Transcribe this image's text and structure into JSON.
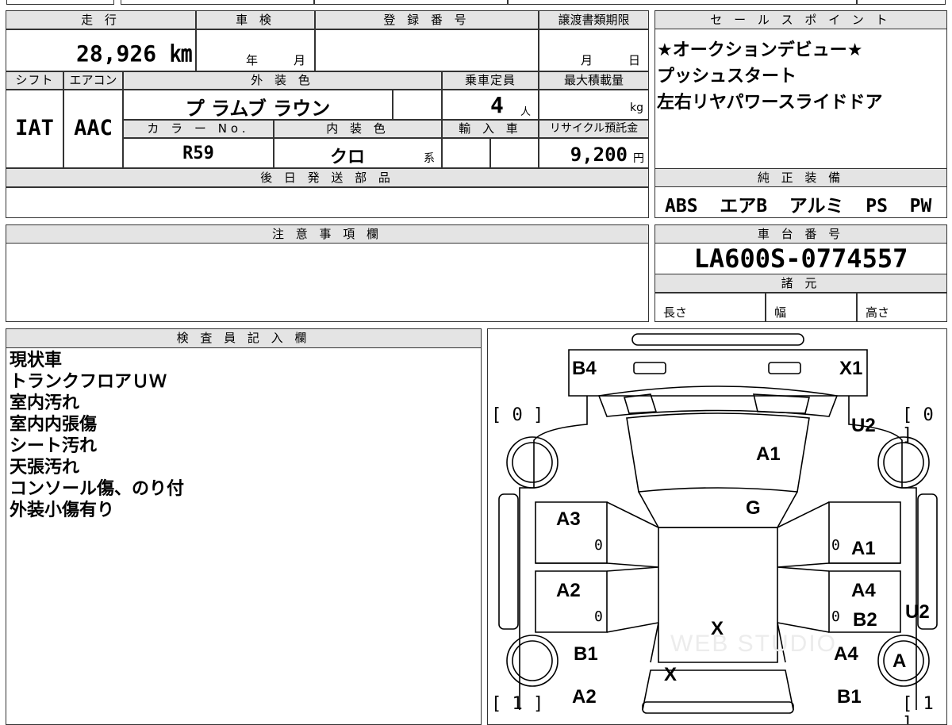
{
  "top_strip": [
    "",
    "",
    "",
    "",
    ""
  ],
  "vehicle": {
    "mileage_label": "走 行",
    "mileage_value": "28,926 ㎞",
    "shaken_label": "車 検",
    "shaken_year": "年",
    "shaken_month": "月",
    "reg_number_label": "登 録 番 号",
    "transfer_deadline_label": "譲渡書類期限",
    "transfer_month": "月",
    "transfer_day": "日",
    "shift_label": "シフト",
    "aircon_label": "エアコン",
    "exterior_color_label": "外 装 色",
    "capacity_label": "乗車定員",
    "max_load_label": "最大積載量",
    "shift_value": "IAT",
    "aircon_value": "AAC",
    "exterior_color_value": "プ ラムブ ラウン",
    "capacity_value": "4",
    "capacity_unit": "人",
    "max_load_unit": "kg",
    "color_no_label": "カ ラ ー No.",
    "interior_color_label": "内 装 色",
    "import_label": "輸 入 車",
    "recycle_label": "リサイクル預託金",
    "color_no_value": "R59",
    "interior_color_value": "クロ",
    "interior_suffix": "系",
    "recycle_value": "9,200",
    "recycle_unit": "円",
    "later_parts_label": "後 日 発 送 部 品"
  },
  "sales_points": {
    "label": "セ ー ル ス ポ イ ン ト",
    "items": [
      "★オークションデビュー★",
      "プッシュスタート",
      "左右リヤパワースライドドア"
    ]
  },
  "genuine_equipment": {
    "label": "純 正 装 備",
    "value": "ABS  エアB  アルミ  PS  PW"
  },
  "notes": {
    "label": "注 意 事 項 欄"
  },
  "chassis": {
    "label": "車 台 番 号",
    "value": "LA600S-0774557",
    "specs_label": "諸 元",
    "length_label": "長さ",
    "width_label": "幅",
    "height_label": "高さ"
  },
  "inspector": {
    "label": "検 査 員 記 入 欄",
    "lines": [
      "現状車",
      "トランクフロアＵＷ",
      "室内汚れ",
      "室内内張傷",
      "シート汚れ",
      "天張汚れ",
      "コンソール傷、のり付",
      "外装小傷有り"
    ]
  },
  "diagram": {
    "watermark": "WEB STUDIO",
    "labels": {
      "b4": "B4",
      "x1": "X1",
      "u2_top": "U2",
      "a1_hood": "A1",
      "g": "G",
      "a3": "A3",
      "a1_right": "A1",
      "a2_left": "A2",
      "a4_right": "A4",
      "b2": "B2",
      "u2_right": "U2",
      "x_center": "X",
      "b1_left": "B1",
      "a4_lower": "A4",
      "a_wheel": "A",
      "x_lower": "X",
      "a2_bottom": "A2",
      "b1_bottom": "B1"
    },
    "zeros": [
      "0",
      "0",
      "0",
      "0"
    ],
    "tire_tl": "[ 0 ]",
    "tire_tr": "[ 0 ]",
    "tire_bl": "[ 1 ]",
    "tire_br": "[ 1 ]"
  }
}
